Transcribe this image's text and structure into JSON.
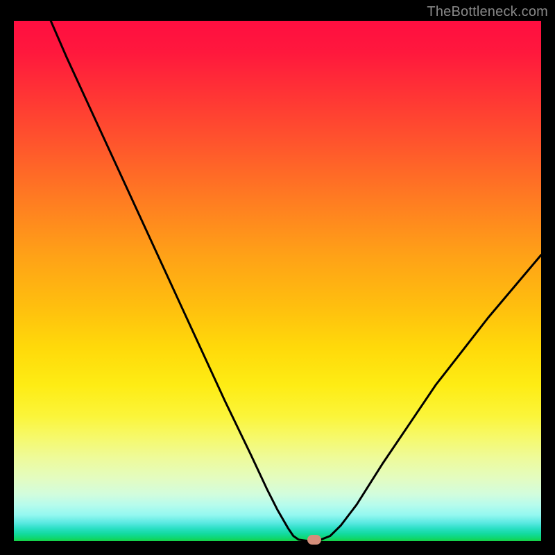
{
  "watermark": "TheBottleneck.com",
  "chart_data": {
    "type": "line",
    "title": "",
    "xlabel": "",
    "ylabel": "",
    "xlim": [
      0,
      100
    ],
    "ylim": [
      0,
      100
    ],
    "grid": false,
    "curve": [
      {
        "x": 7,
        "y": 100
      },
      {
        "x": 10,
        "y": 93
      },
      {
        "x": 15,
        "y": 82
      },
      {
        "x": 20,
        "y": 71
      },
      {
        "x": 25,
        "y": 60
      },
      {
        "x": 30,
        "y": 49
      },
      {
        "x": 35,
        "y": 38
      },
      {
        "x": 40,
        "y": 27
      },
      {
        "x": 45,
        "y": 16.5
      },
      {
        "x": 48,
        "y": 10
      },
      {
        "x": 50,
        "y": 6
      },
      {
        "x": 52,
        "y": 2.5
      },
      {
        "x": 53,
        "y": 1
      },
      {
        "x": 54,
        "y": 0.3
      },
      {
        "x": 56,
        "y": 0
      },
      {
        "x": 58,
        "y": 0.2
      },
      {
        "x": 60,
        "y": 1
      },
      {
        "x": 62,
        "y": 3
      },
      {
        "x": 65,
        "y": 7
      },
      {
        "x": 70,
        "y": 15
      },
      {
        "x": 75,
        "y": 22.5
      },
      {
        "x": 80,
        "y": 30
      },
      {
        "x": 85,
        "y": 36.5
      },
      {
        "x": 90,
        "y": 43
      },
      {
        "x": 95,
        "y": 49
      },
      {
        "x": 100,
        "y": 55
      }
    ],
    "marker": {
      "x": 57,
      "y": 0.3,
      "color": "#d58e7a"
    },
    "background": {
      "type": "vertical-gradient",
      "stops": [
        {
          "pct": 0,
          "color": "#ff0e40"
        },
        {
          "pct": 50,
          "color": "#ffb012"
        },
        {
          "pct": 75,
          "color": "#fbf53a"
        },
        {
          "pct": 100,
          "color": "#15d244"
        }
      ]
    }
  }
}
